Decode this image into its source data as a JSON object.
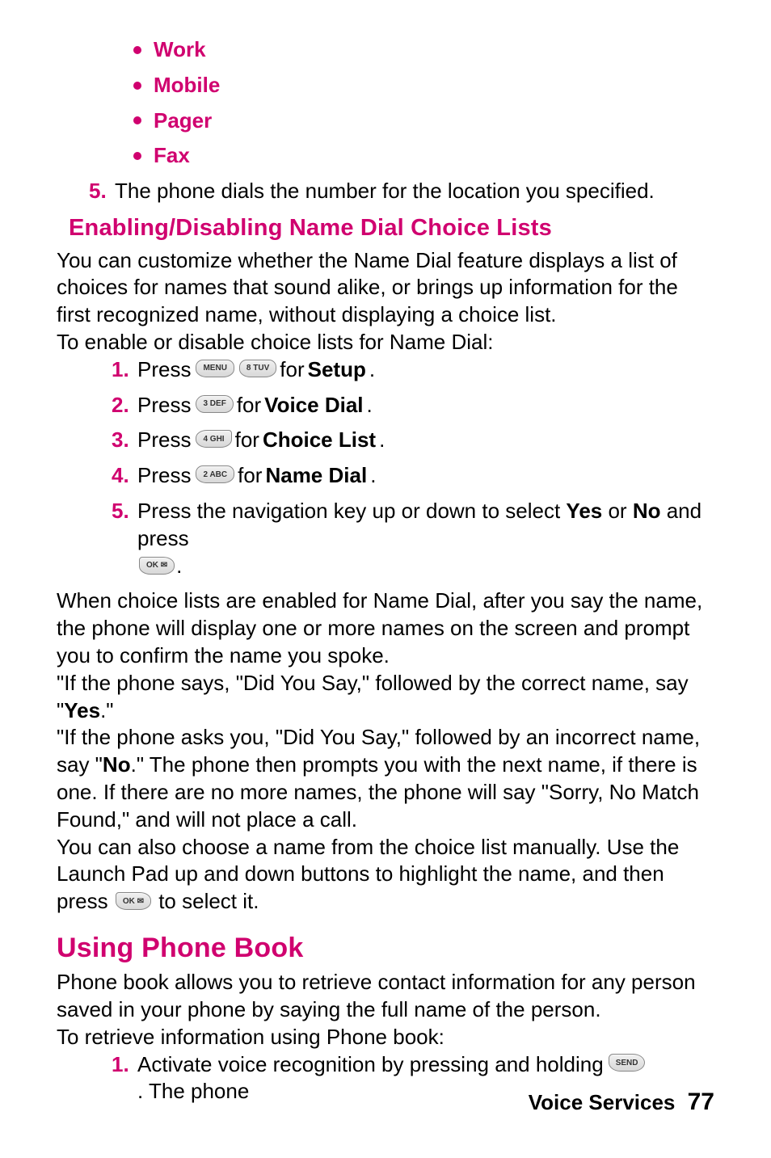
{
  "bullets": {
    "items": [
      {
        "label": "Work"
      },
      {
        "label": "Mobile"
      },
      {
        "label": "Pager"
      },
      {
        "label": "Fax"
      }
    ]
  },
  "topstep": {
    "num": "5.",
    "text": "The phone dials the number for the location you specified."
  },
  "section1": {
    "heading": "Enabling/Disabling Name Dial Choice Lists",
    "intro": "You can customize whether the Name Dial feature displays a list of choices for names that sound alike, or brings up information for the first recognized name, without displaying a choice list.",
    "lead": "To enable or disable choice lists for Name Dial:",
    "steps": {
      "s1": {
        "num": "1.",
        "t1": "Press ",
        "key1": "MENU",
        "key2": "8 TUV",
        "t2": " for ",
        "bold": "Setup",
        "t3": "."
      },
      "s2": {
        "num": "2.",
        "t1": "Press ",
        "key1": "3 DEF",
        "t2": " for ",
        "bold": "Voice Dial",
        "t3": "."
      },
      "s3": {
        "num": "3.",
        "t1": "Press ",
        "key1": "4 GHI",
        "t2": " for ",
        "bold": "Choice List",
        "t3": "."
      },
      "s4": {
        "num": "4.",
        "t1": "Press ",
        "key1": "2 ABC",
        "t2": " for ",
        "bold": "Name Dial",
        "t3": "."
      },
      "s5": {
        "num": "5.",
        "t1": "Press the navigation key up or down to select ",
        "bold1": "Yes",
        "t2": " or ",
        "bold2": "No",
        "t3": " and press ",
        "key1": "OK ✉",
        "t4": "."
      }
    },
    "after1": "When choice lists are enabled for Name Dial, after you say the name, the phone will display one or more names on the screen and prompt you to confirm the name you spoke.",
    "after2a": "\"If the phone says, \"Did You Say,\" followed by the correct name, say \"",
    "after2b": "Yes",
    "after2c": ".\"",
    "after3a": "\"If the phone asks you, \"Did You Say,\" followed by an incorrect name, say \"",
    "after3b": "No",
    "after3c": ".\" The phone then prompts you with the next name, if there is one. If there are no more names, the phone will say \"Sorry, No Match Found,\" and will not place a call.",
    "after4a": "You can also choose a name from the choice list manually. Use the Launch Pad up and down buttons to highlight the name, and then press ",
    "after4key": "OK ✉",
    "after4b": " to select it."
  },
  "section2": {
    "heading": "Using Phone Book",
    "intro": "Phone book allows you to retrieve contact information for any person saved in your phone by saying the full name of the person.",
    "lead": "To retrieve information using Phone book:",
    "steps": {
      "s1": {
        "num": "1.",
        "t1": "Activate voice recognition by pressing and holding ",
        "key1": "SEND",
        "t2": ". The phone"
      }
    }
  },
  "footer": {
    "label": "Voice Services",
    "page": "77"
  }
}
